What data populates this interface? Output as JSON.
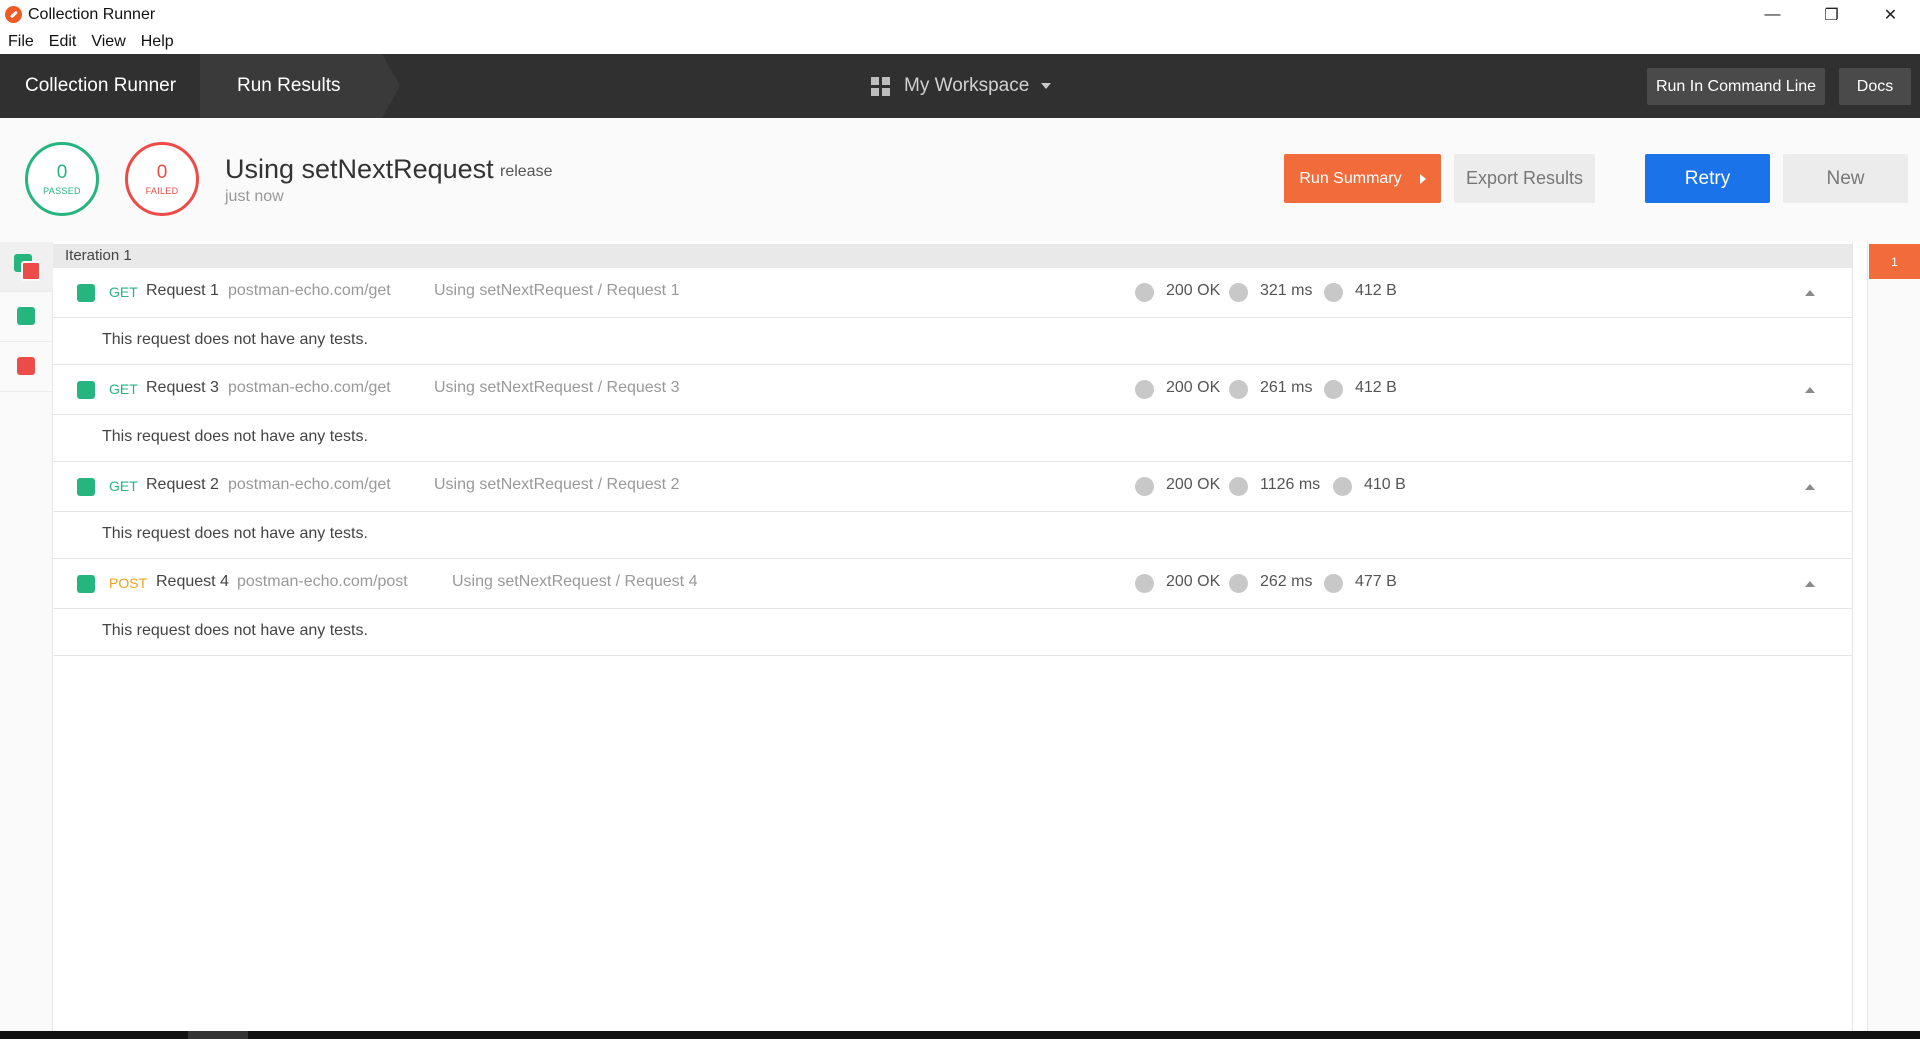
{
  "window": {
    "title": "Collection Runner",
    "controls": {
      "minimize": "—",
      "restore": "❐",
      "close": "✕"
    }
  },
  "menu": [
    "File",
    "Edit",
    "View",
    "Help"
  ],
  "header": {
    "breadcrumb_root": "Collection Runner",
    "breadcrumb_current": "Run Results",
    "workspace": "My Workspace",
    "run_cli_label": "Run In Command Line",
    "docs_label": "Docs"
  },
  "summary": {
    "passed_count": "0",
    "passed_label": "PASSED",
    "failed_count": "0",
    "failed_label": "FAILED",
    "run_name": "Using setNextRequest",
    "environment": "release",
    "time": "just now",
    "run_summary_label": "Run Summary",
    "export_label": "Export Results",
    "retry_label": "Retry",
    "new_label": "New",
    "colors": {
      "passed": "#26b47f",
      "failed": "#ed4b48",
      "accent": "#f26b3a",
      "primary": "#1a73e8"
    }
  },
  "iteration": {
    "label": "Iteration 1",
    "marker": "1"
  },
  "requests": [
    {
      "method": "GET",
      "name": "Request 1",
      "url": "postman-echo.com/get",
      "path": "Using setNextRequest / Request 1",
      "status": "200 OK",
      "time": "321 ms",
      "size": "412 B",
      "message": "This request does not have any tests."
    },
    {
      "method": "GET",
      "name": "Request 3",
      "url": "postman-echo.com/get",
      "path": "Using setNextRequest / Request 3",
      "status": "200 OK",
      "time": "261 ms",
      "size": "412 B",
      "message": "This request does not have any tests."
    },
    {
      "method": "GET",
      "name": "Request 2",
      "url": "postman-echo.com/get",
      "path": "Using setNextRequest / Request 2",
      "status": "200 OK",
      "time": "1126 ms",
      "size": "410 B",
      "message": "This request does not have any tests."
    },
    {
      "method": "POST",
      "name": "Request 4",
      "url": "postman-echo.com/post",
      "path": "Using setNextRequest / Request 4",
      "status": "200 OK",
      "time": "262 ms",
      "size": "477 B",
      "message": "This request does not have any tests."
    }
  ]
}
